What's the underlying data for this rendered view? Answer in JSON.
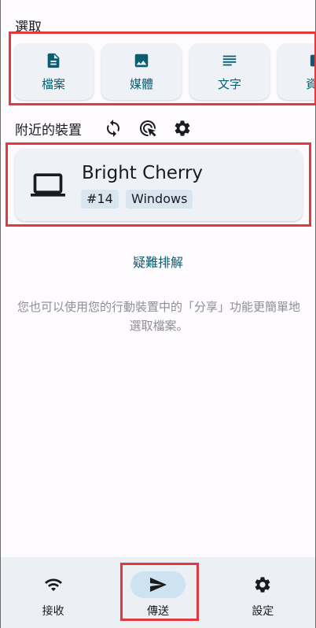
{
  "section_title": "選取",
  "pick_cards": [
    {
      "label": "檔案",
      "icon": "file-icon"
    },
    {
      "label": "媒體",
      "icon": "image-icon"
    },
    {
      "label": "文字",
      "icon": "text-icon"
    },
    {
      "label": "資料",
      "icon": "folder-icon"
    }
  ],
  "nearby": {
    "title": "附近的裝置"
  },
  "device": {
    "name": "Bright Cherry",
    "tag_number": "#14",
    "tag_os": "Windows"
  },
  "troubleshoot": "疑難排解",
  "hint": "您也可以使用您的行動裝置中的「分享」功能更簡單地選取檔案。",
  "nav": {
    "receive": "接收",
    "send": "傳送",
    "settings": "設定",
    "active": "send"
  },
  "colors": {
    "accent": "#0b5d72",
    "card_bg": "#eef1f6",
    "highlight": "#e0393e"
  }
}
